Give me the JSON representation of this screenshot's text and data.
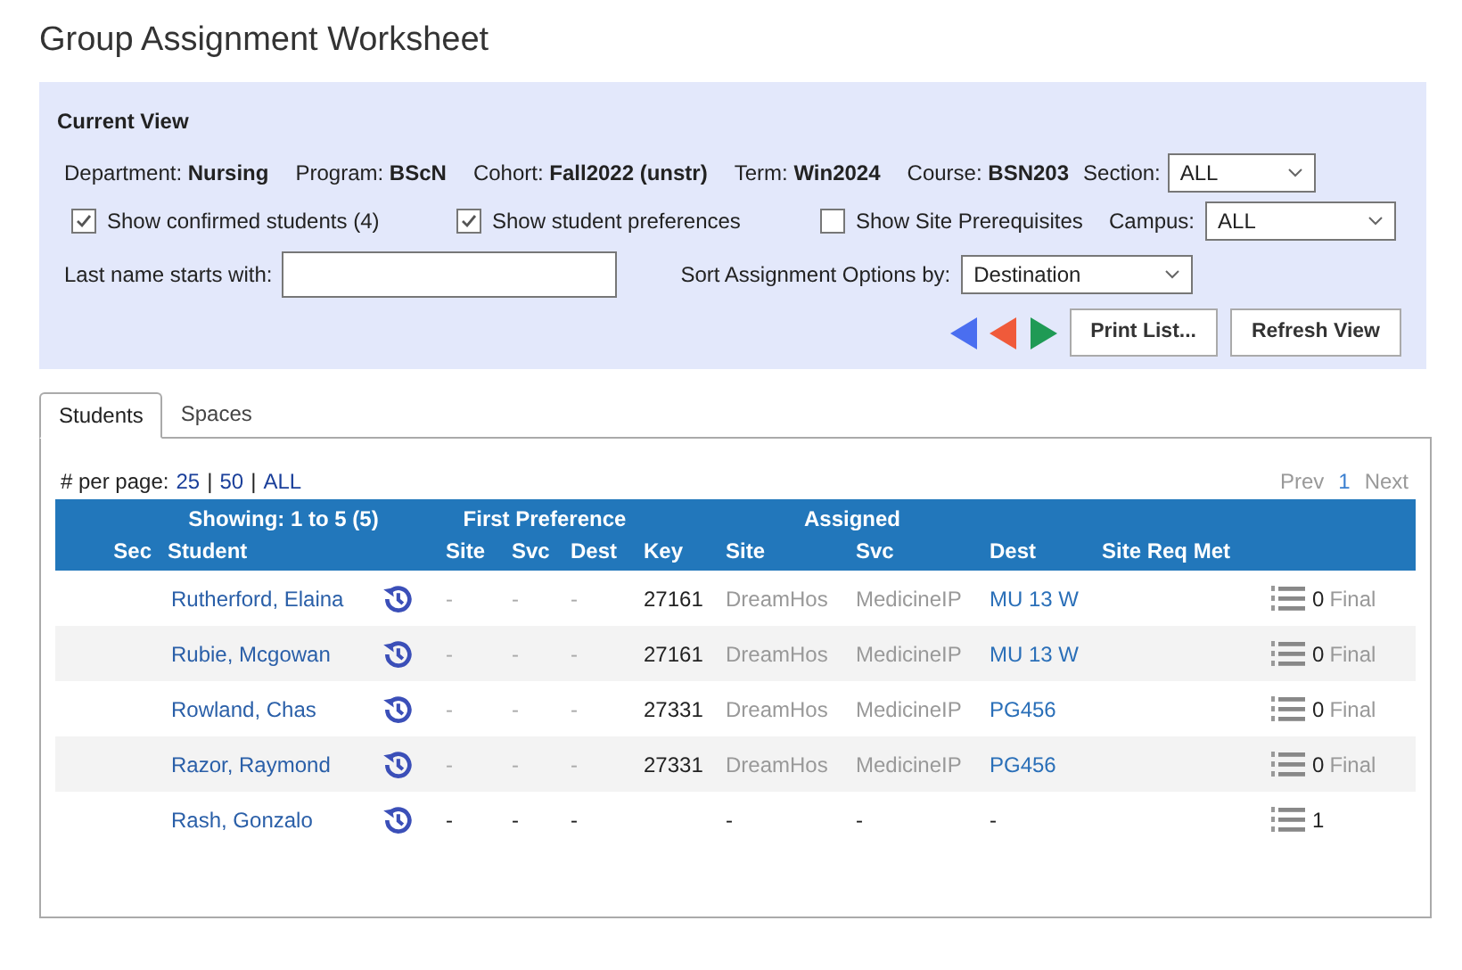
{
  "title": "Group Assignment Worksheet",
  "current_view": {
    "heading": "Current View",
    "fields": [
      {
        "label": "Department:",
        "value": "Nursing"
      },
      {
        "label": "Program:",
        "value": "BScN"
      },
      {
        "label": "Cohort:",
        "value": "Fall2022 (unstr)"
      },
      {
        "label": "Term:",
        "value": "Win2024"
      },
      {
        "label": "Course:",
        "value": "BSN203"
      }
    ],
    "section": {
      "label": "Section:",
      "value": "ALL"
    },
    "checkboxes": [
      {
        "label": "Show confirmed students (4)",
        "checked": true
      },
      {
        "label": "Show student preferences",
        "checked": true
      },
      {
        "label": "Show Site Prerequisites",
        "checked": false
      }
    ],
    "campus": {
      "label": "Campus:",
      "value": "ALL"
    },
    "last_name": {
      "label": "Last name starts with:"
    },
    "sort": {
      "label": "Sort Assignment Options by:",
      "value": "Destination"
    },
    "buttons": [
      "Print List...",
      "Refresh View"
    ]
  },
  "tabs": [
    {
      "label": "Students",
      "selected": true
    },
    {
      "label": "Spaces",
      "selected": false
    }
  ],
  "per_page": {
    "label": "# per page:",
    "options": [
      "25",
      "50",
      "ALL"
    ],
    "separator": "|"
  },
  "pager": {
    "prev": "Prev",
    "page": "1",
    "next": "Next"
  },
  "table": {
    "group_headers": [
      "Showing: 1 to 5 (5)",
      "First Preference",
      "Assigned"
    ],
    "columns": [
      "Sec",
      "Student",
      "Site",
      "Svc",
      "Dest",
      "Key",
      "Site",
      "Svc",
      "Dest",
      "Site Req Met"
    ],
    "rows": [
      {
        "student": "Rutherford, Elaina",
        "pref_site": "-",
        "pref_svc": "-",
        "pref_dest": "-",
        "key": "27161",
        "site": "DreamHos",
        "svc": "MedicineIP",
        "dest": "MU 13 W",
        "count": "0",
        "status": "Final",
        "confirmed": true
      },
      {
        "student": "Rubie, Mcgowan",
        "pref_site": "-",
        "pref_svc": "-",
        "pref_dest": "-",
        "key": "27161",
        "site": "DreamHos",
        "svc": "MedicineIP",
        "dest": "MU 13 W",
        "count": "0",
        "status": "Final",
        "confirmed": true
      },
      {
        "student": "Rowland, Chas",
        "pref_site": "-",
        "pref_svc": "-",
        "pref_dest": "-",
        "key": "27331",
        "site": "DreamHos",
        "svc": "MedicineIP",
        "dest": "PG456",
        "count": "0",
        "status": "Final",
        "confirmed": true
      },
      {
        "student": "Razor, Raymond",
        "pref_site": "-",
        "pref_svc": "-",
        "pref_dest": "-",
        "key": "27331",
        "site": "DreamHos",
        "svc": "MedicineIP",
        "dest": "PG456",
        "count": "0",
        "status": "Final",
        "confirmed": true
      },
      {
        "student": "Rash, Gonzalo",
        "pref_site": "-",
        "pref_svc": "-",
        "pref_dest": "-",
        "site": "-",
        "svc": "-",
        "dest": "-",
        "count": "1",
        "confirmed": false
      }
    ]
  }
}
